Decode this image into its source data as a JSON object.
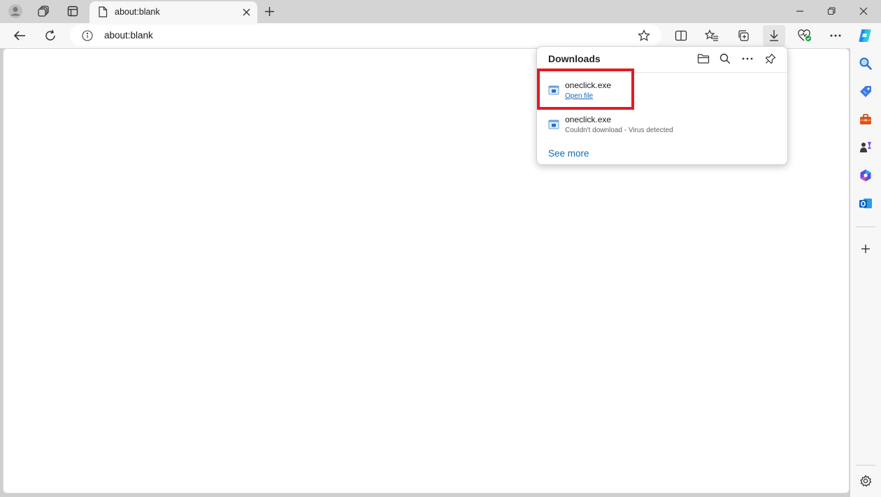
{
  "tab": {
    "title": "about:blank"
  },
  "address_bar": {
    "url": "about:blank"
  },
  "downloads": {
    "title": "Downloads",
    "items": [
      {
        "filename": "oneclick.exe",
        "action": "Open file"
      },
      {
        "filename": "oneclick.exe",
        "status": "Couldn't download - Virus detected"
      }
    ],
    "see_more": "See more"
  },
  "colors": {
    "accent": "#0f6cbd",
    "highlight": "#e01b24",
    "chrome": "#d4d4d4",
    "toolbar": "#f7f7f7"
  },
  "icons": {
    "tabstrip": [
      "profile-icon",
      "workspaces-icon",
      "tab-actions-icon",
      "page-icon",
      "close-icon",
      "plus-icon"
    ],
    "window": [
      "minimize-icon",
      "restore-icon",
      "close-icon"
    ],
    "toolbar": [
      "back-icon",
      "refresh-icon",
      "info-icon",
      "star-icon",
      "split-screen-icon",
      "favorites-icon",
      "collections-icon",
      "download-icon",
      "browser-essentials-icon",
      "more-icon",
      "copilot-icon"
    ],
    "sidebar": [
      "search-icon",
      "shopping-icon",
      "tools-icon",
      "games-icon",
      "microsoft365-icon",
      "outlook-icon",
      "plus-icon",
      "settings-icon"
    ],
    "flyout": [
      "folder-icon",
      "search-icon",
      "more-icon",
      "pin-icon",
      "exe-file-icon"
    ]
  }
}
